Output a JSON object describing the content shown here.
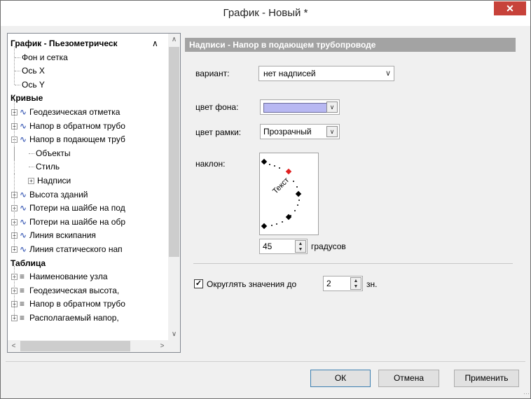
{
  "window": {
    "title": "График - Новый *",
    "close_glyph": "✕"
  },
  "tree": {
    "rows": [
      {
        "label": "График - Пьезометрическ",
        "bold": true
      },
      {
        "label": "Фон и сетка"
      },
      {
        "label": "Ось X"
      },
      {
        "label": "Ось Y"
      },
      {
        "label": "Кривые",
        "bold": true
      },
      {
        "label": "Геодезическая отметка"
      },
      {
        "label": "Напор в обратном трубо"
      },
      {
        "label": "Напор в подающем труб"
      },
      {
        "label": "Объекты"
      },
      {
        "label": "Стиль"
      },
      {
        "label": "Надписи"
      },
      {
        "label": "Высота зданий"
      },
      {
        "label": "Потери на шайбе на под"
      },
      {
        "label": "Потери на шайбе на обр"
      },
      {
        "label": "Линия вскипания"
      },
      {
        "label": "Линия статического нап"
      },
      {
        "label": "Таблица",
        "bold": true
      },
      {
        "label": "Наименование узла"
      },
      {
        "label": "Геодезическая высота,"
      },
      {
        "label": "Напор в обратном трубо"
      },
      {
        "label": "Располагаемый напор,"
      }
    ],
    "expand_plus": "+",
    "expand_minus": "−",
    "curve_icon": "curve-icon",
    "table_icon": "table-icon",
    "scroll_up": "∧",
    "scroll_down": "∨",
    "scroll_left": "<",
    "scroll_right": ">"
  },
  "panel": {
    "header": "Надписи - Напор в подающем трубопроводе",
    "variant_label": "вариант:",
    "variant_value": "нет надписей",
    "bg_color_label": "цвет фона:",
    "bg_color": "#b8b8f2",
    "border_color_label": "цвет рамки:",
    "border_color_value": "Прозрачный",
    "slant_label": "наклон:",
    "slant_sample_text": "Текст",
    "slant_value": "45",
    "slant_unit": "градусов",
    "round_label": "Округлять значения до",
    "round_checked": true,
    "round_value": "2",
    "round_unit": "зн."
  },
  "buttons": {
    "ok": "ОК",
    "cancel": "Отмена",
    "apply": "Применить"
  },
  "colors": {
    "header_bg": "#a3a3a3",
    "close_bg": "#c7423a",
    "marker_red": "#e02020"
  }
}
